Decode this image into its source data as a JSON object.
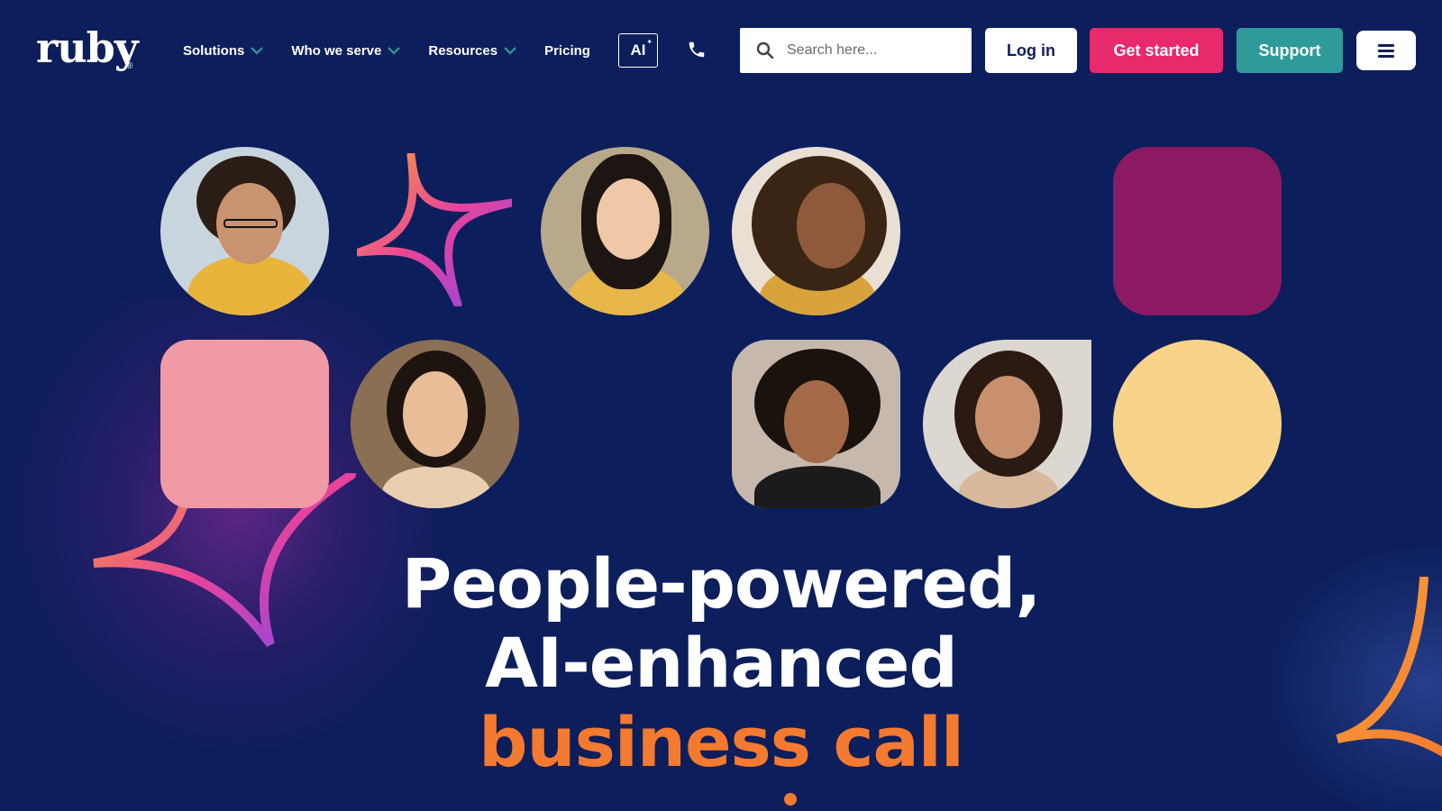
{
  "brand": {
    "logo_text": "ruby",
    "registered_mark": "®"
  },
  "nav": {
    "items": [
      {
        "label": "Solutions",
        "has_dropdown": true
      },
      {
        "label": "Who we serve",
        "has_dropdown": true
      },
      {
        "label": "Resources",
        "has_dropdown": true
      },
      {
        "label": "Pricing",
        "has_dropdown": false
      }
    ],
    "ai_badge": "AI"
  },
  "search": {
    "placeholder": "Search here...",
    "value": ""
  },
  "buttons": {
    "login": "Log in",
    "get_started": "Get started",
    "support": "Support"
  },
  "hero": {
    "line1": "People-powered,",
    "line2": "AI-enhanced",
    "line3": "business call"
  },
  "colors": {
    "background": "#0c1e5b",
    "accent_pink": "#e8296b",
    "accent_teal": "#2f9a9a",
    "accent_orange": "#f47a30",
    "tile_magenta": "#8c1a62",
    "tile_pink": "#ef9aa4",
    "tile_yellow": "#f8d38a"
  },
  "icons": [
    "phone-icon",
    "search-icon",
    "menu-icon",
    "chevron-down-icon",
    "sparkle-star-icon"
  ]
}
